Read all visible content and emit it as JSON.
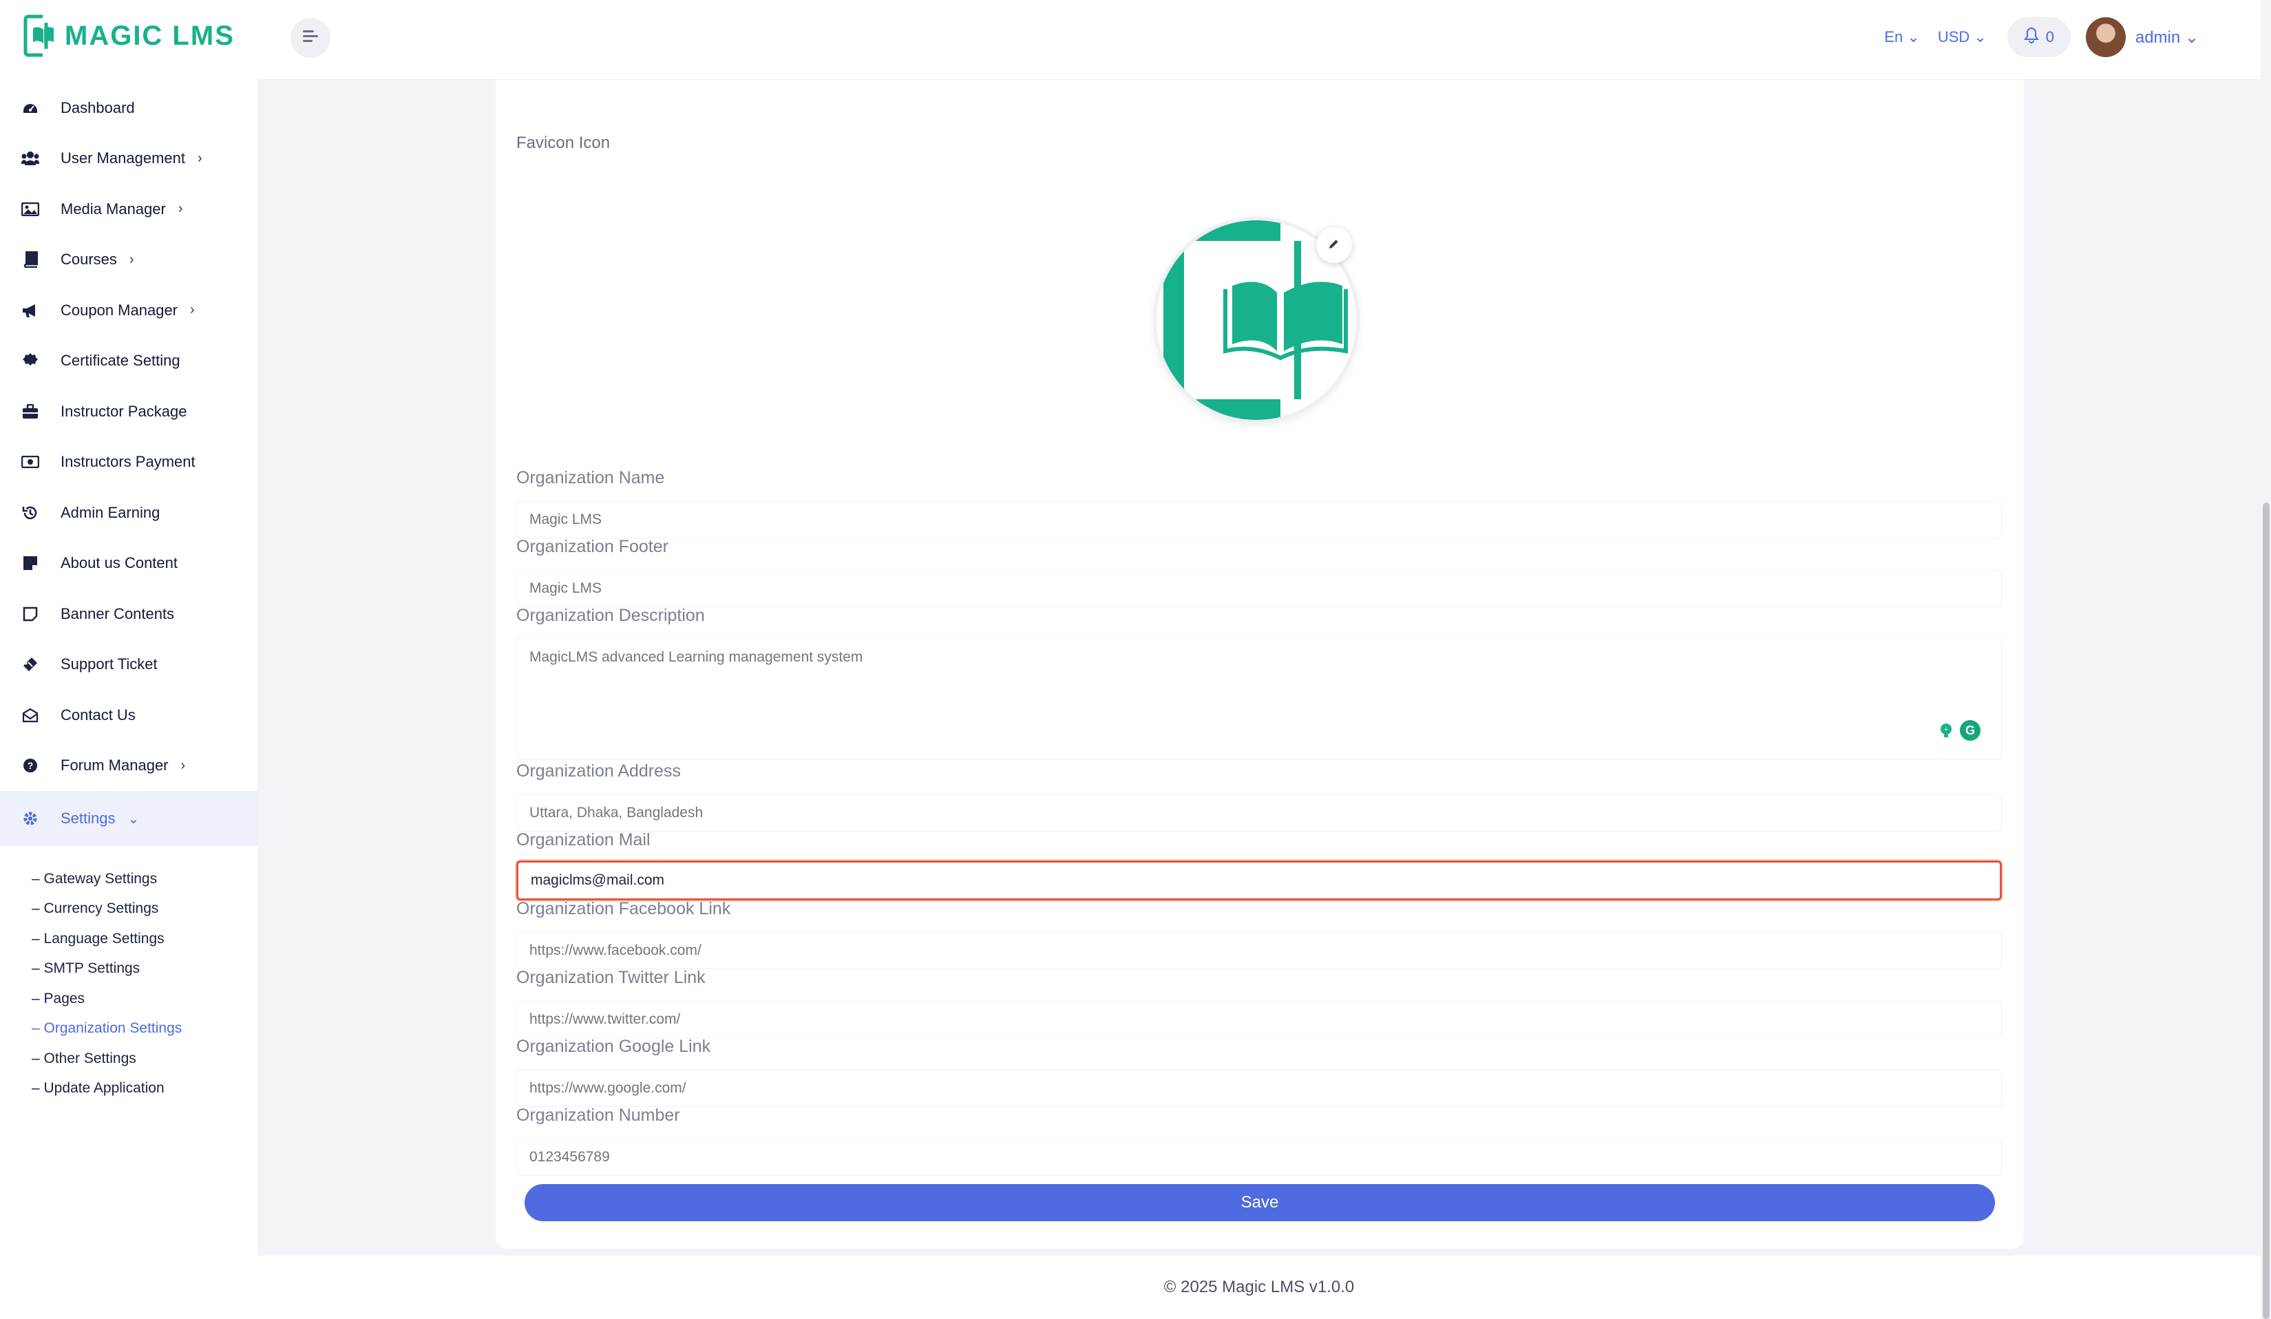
{
  "brand": {
    "name": "MAGIC LMS",
    "color": "#17b18c",
    "accent": "#4d6bdc"
  },
  "header": {
    "language": "En",
    "currency": "USD",
    "notifications_count": "0",
    "user_name": "admin"
  },
  "sidebar": {
    "items": [
      {
        "label": "Dashboard",
        "icon": "dashboard-icon"
      },
      {
        "label": "User Management",
        "icon": "users-icon"
      },
      {
        "label": "Media Manager",
        "icon": "image-icon"
      },
      {
        "label": "Courses",
        "icon": "book-icon"
      },
      {
        "label": "Coupon Manager",
        "icon": "megaphone-icon"
      },
      {
        "label": "Certificate Setting",
        "icon": "certificate-icon"
      },
      {
        "label": "Instructor Package",
        "icon": "briefcase-icon"
      },
      {
        "label": "Instructors Payment",
        "icon": "money-icon"
      },
      {
        "label": "Admin Earning",
        "icon": "history-icon"
      },
      {
        "label": "About us Content",
        "icon": "note-icon"
      },
      {
        "label": "Banner Contents",
        "icon": "sticky-note-icon"
      },
      {
        "label": "Support Ticket",
        "icon": "ticket-icon"
      },
      {
        "label": "Contact Us",
        "icon": "envelope-icon"
      },
      {
        "label": "Forum Manager",
        "icon": "question-icon"
      },
      {
        "label": "Settings",
        "icon": "gear-icon"
      }
    ],
    "settings_sub": [
      "– Gateway Settings",
      "– Currency Settings",
      "– Language Settings",
      "– SMTP Settings",
      "– Pages",
      "– Organization Settings",
      "– Other Settings",
      "– Update Application"
    ]
  },
  "form": {
    "favicon_label": "Favicon Icon",
    "name_label": "Organization Name",
    "name_value": "Magic LMS",
    "footer_label": "Organization Footer",
    "footer_value": "Magic LMS",
    "description_label": "Organization Description",
    "description_value": "MagicLMS advanced Learning management system",
    "address_label": "Organization Address",
    "address_value": "Uttara, Dhaka, Bangladesh",
    "mail_label": "Organization Mail",
    "mail_value": "magiclms@mail.com",
    "facebook_label": "Organization Facebook Link",
    "facebook_value": "https://www.facebook.com/",
    "twitter_label": "Organization Twitter Link",
    "twitter_value": "https://www.twitter.com/",
    "google_label": "Organization Google Link",
    "google_value": "https://www.google.com/",
    "number_label": "Organization Number",
    "number_value": "0123456789",
    "save_label": "Save"
  },
  "footer": {
    "copyright": "© 2025 Magic LMS v1.0.0"
  }
}
